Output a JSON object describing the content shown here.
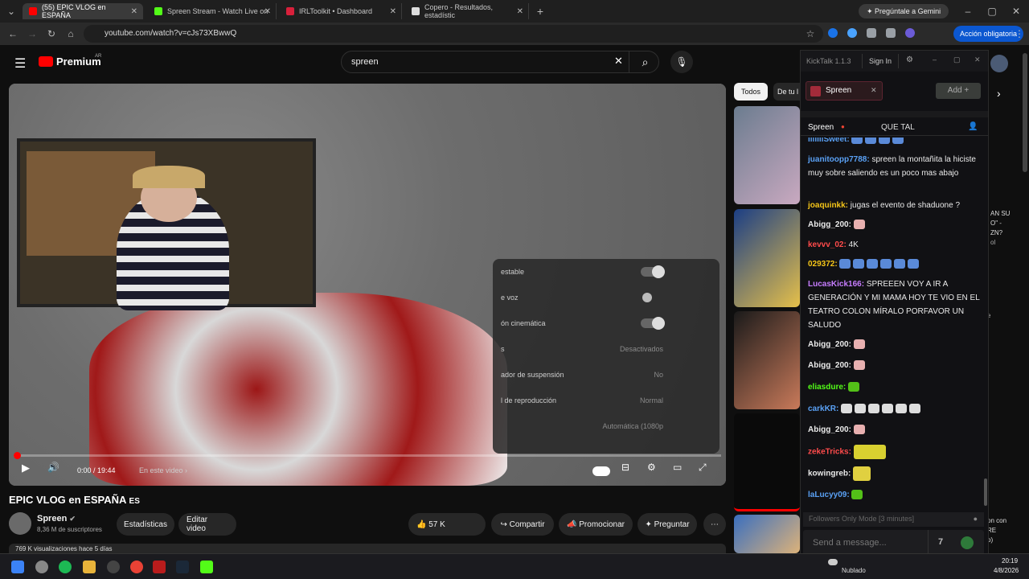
{
  "tabs": [
    {
      "label": "(55) EPIC VLOG en ESPAÑA",
      "color": "#ff0000"
    },
    {
      "label": "Spreen Stream - Watch Live on",
      "color": "#53fc18"
    },
    {
      "label": "IRLToolkit • Dashboard",
      "color": "#d8203b"
    },
    {
      "label": "Copero - Resultados, estadístic",
      "color": "#dddddd"
    }
  ],
  "new_tab": "+",
  "gemini": "Pregúntale a Gemini",
  "url": "youtube.com/watch?v=cJs73XBwwQ",
  "accion": "Acción obligatoria",
  "yt": {
    "brand": "Premium",
    "region": "AR",
    "search_value": "spreen",
    "video_title": "EPIC VLOG en ESPAÑA",
    "title_tag": "ES",
    "channel": "Spreen",
    "subs": "8,36 M de suscriptores",
    "btn_stats": "Estadísticas",
    "btn_edit": "Editar video",
    "likes": "57 K",
    "share": "Compartir",
    "promote": "Promocionar",
    "ask": "Preguntar",
    "views": "769 K visualizaciones hace 5 días",
    "time": "0:00 / 19:44",
    "chapter": "En este video",
    "chip_all": "Todos",
    "chip_2": "De tu l",
    "side_text": [
      "AN SU",
      "O\" -",
      "ZN?",
      "ol",
      "e",
      "on con",
      "RE",
      "o)"
    ]
  },
  "settings": [
    {
      "label": "estable",
      "type": "toggle"
    },
    {
      "label": "e voz",
      "type": "dot"
    },
    {
      "label": "ón cinemática",
      "type": "toggle"
    },
    {
      "label": "s",
      "value": "Desactivados"
    },
    {
      "label": "ador de suspensión",
      "value": "No"
    },
    {
      "label": "l de reproducción",
      "value": "Normal"
    },
    {
      "label": "",
      "value": "Automática (1080p"
    }
  ],
  "kick": {
    "app": "KickTalk 1.1.3",
    "signin": "Sign In",
    "channel_tab": "Spreen",
    "add": "Add",
    "chat_header_channel": "Spreen",
    "chat_header_title": "QUE TAL",
    "messages": [
      {
        "user": "lllllllSweet:",
        "color": "#5aa1f5",
        "text": ""
      },
      {
        "user": "juanitoopp7788:",
        "color": "#5aa1f5",
        "text": "spreen la montañita la hiciste muy sobre saliendo es un poco mas abajo"
      },
      {
        "user": "joaquinkk:",
        "color": "#f5c518",
        "text": "jugas el evento de shaduone ?"
      },
      {
        "user": "Abigg_200:",
        "color": "#eaeaea",
        "text": ""
      },
      {
        "user": "kevvv_02:",
        "color": "#ff4b4b",
        "text": "4K"
      },
      {
        "user": "029372:",
        "color": "#f5c518",
        "text": ""
      },
      {
        "user": "LucasKick166:",
        "color": "#c77dff",
        "text": "SPREEEN VOY A IR A GENERACIÓN Y MI MAMA HOY TE VIO EN EL TEATRO COLON MÍRALO PORFAVOR UN SALUDO"
      },
      {
        "user": "Abigg_200:",
        "color": "#eaeaea",
        "text": ""
      },
      {
        "user": "Abigg_200:",
        "color": "#eaeaea",
        "text": ""
      },
      {
        "user": "eliasdure:",
        "color": "#53fc18",
        "text": ""
      },
      {
        "user": "carkKR:",
        "color": "#5aa1f5",
        "text": ""
      },
      {
        "user": "Abigg_200:",
        "color": "#eaeaea",
        "text": ""
      },
      {
        "user": "zekeTricks:",
        "color": "#ff4b4b",
        "text": ""
      },
      {
        "user": "kowingreb:",
        "color": "#eaeaea",
        "text": ""
      },
      {
        "user": "laLucyy09:",
        "color": "#5aa1f5",
        "text": ""
      }
    ],
    "followers_mode": "Followers Only Mode [3 minutes]",
    "placeholder": "Send a message..."
  },
  "taskbar": {
    "weather": "Nublado",
    "time": "20:19",
    "date": "4/8/2026"
  }
}
